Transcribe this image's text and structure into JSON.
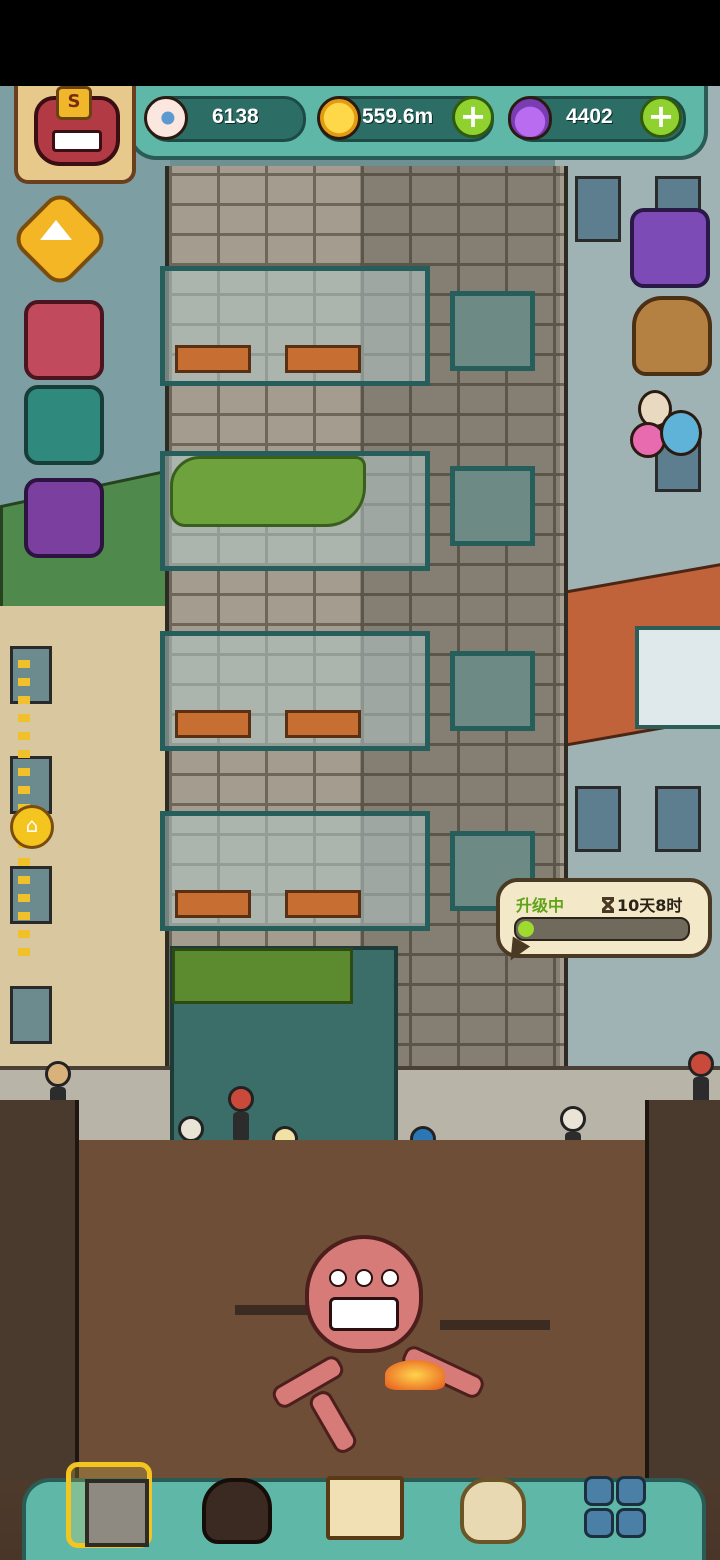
{
  "hud": {
    "eyeballs": "6138",
    "coins": "559.6m",
    "potions": "4402",
    "plus_symbol": "+",
    "rank_badge": "S"
  },
  "upgrade": {
    "status": "升级中",
    "timer": "10天8时",
    "progress": 0.06
  },
  "icons": {
    "eyeball": "eyeball-icon",
    "coin": "coin-icon",
    "potion": "potion-icon",
    "collapse": "chevron-up-icon",
    "home": "home-icon",
    "gift": "gift-icon",
    "gift2": "gift-box-icon",
    "cards": "cards-icon",
    "tv": "tv-icon",
    "backpack": "backpack-icon",
    "monster_eggs": "monster-eggs-icon"
  },
  "nav": {
    "items": [
      {
        "name": "building",
        "selected": true
      },
      {
        "name": "monster",
        "selected": false
      },
      {
        "name": "book",
        "selected": false
      },
      {
        "name": "money-bag",
        "selected": false
      },
      {
        "name": "grid",
        "selected": false
      }
    ]
  },
  "colors": {
    "hud_bg": "#5fb7a8",
    "hud_border": "#2a5c55",
    "accent_green": "#8fd12e",
    "accent_yellow": "#f4c51f",
    "upgrade_green": "#5fa317"
  }
}
